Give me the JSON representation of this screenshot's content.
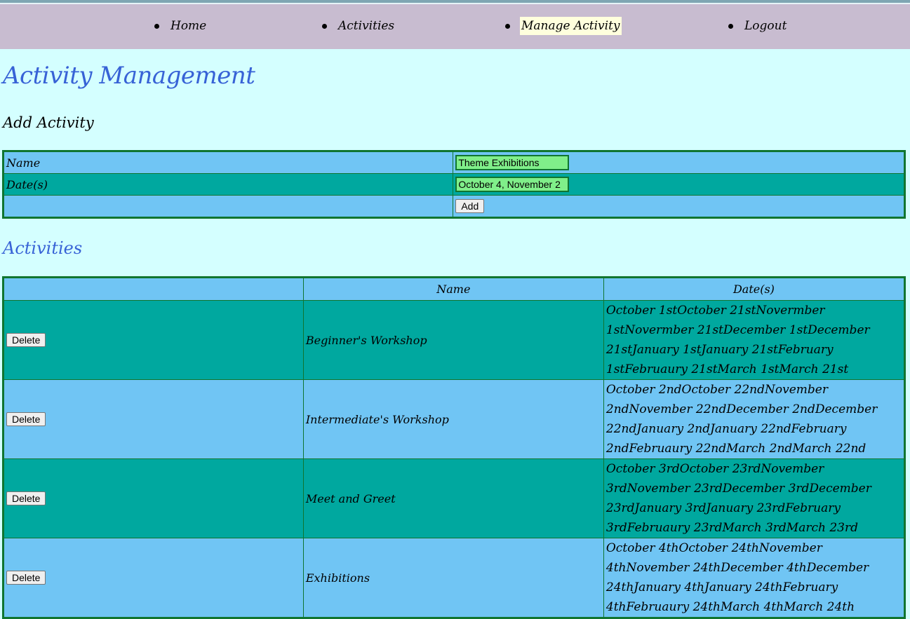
{
  "nav": {
    "items": [
      {
        "label": "Home",
        "active": false
      },
      {
        "label": "Activities",
        "active": false
      },
      {
        "label": "Manage Activity",
        "active": true
      },
      {
        "label": "Logout",
        "active": false
      }
    ]
  },
  "page": {
    "title": "Activity Management",
    "add_heading": "Add Activity",
    "list_heading": "Activities"
  },
  "form": {
    "name_label": "Name",
    "name_value": "Theme Exhibitions",
    "dates_label": "Date(s)",
    "dates_value": "October 4, November 2",
    "add_label": "Add"
  },
  "table": {
    "headers": [
      "",
      "Name",
      "Date(s)"
    ],
    "delete_label": "Delete",
    "rows": [
      {
        "name": "Beginner's Workshop",
        "dates": "October 1stOctober 21stNovermber 1stNovermber 21stDecember 1stDecember 21stJanuary 1stJanuary 21stFebruary 1stFebruaury 21stMarch 1stMarch 21st"
      },
      {
        "name": "Intermediate's Workshop",
        "dates": "October 2ndOctober 22ndNovember 2ndNovember 22ndDecember 2ndDecember 22ndJanuary 2ndJanuary 22ndFebruary 2ndFebruaury 22ndMarch 2ndMarch 22nd"
      },
      {
        "name": "Meet and Greet",
        "dates": "October 3rdOctober 23rdNovember 3rdNovember 23rdDecember 3rdDecember 23rdJanuary 3rdJanuary 23rdFebruary 3rdFebruaury 23rdMarch 3rdMarch 23rd"
      },
      {
        "name": "Exhibitions",
        "dates": "October 4thOctober 24thNovember 4thNovember 24thDecember 4thDecember 24thJanuary 4thJanuary 24thFebruary 4thFebruaury 24thMarch 4thMarch 24th"
      }
    ]
  },
  "colors": {
    "page_background": "#d4ffff",
    "nav_background": "#c8bcd0",
    "heading_blue": "#3762d6",
    "row_light": "#70c5f4",
    "row_dark": "#00a89f",
    "table_border": "#107530",
    "input_background": "#80ef8a",
    "active_nav_highlight": "#ffffdd"
  }
}
